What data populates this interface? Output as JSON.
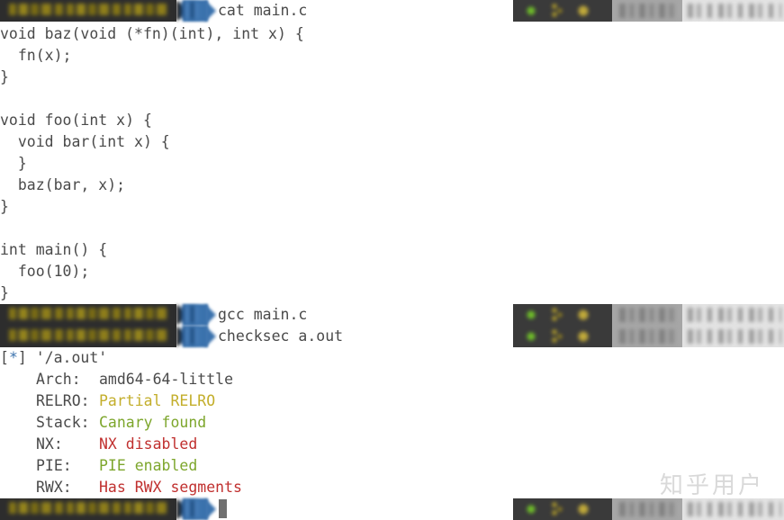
{
  "terminal": {
    "background_color": "#ffffff",
    "default_text_color": "#4a4a4a",
    "colors": {
      "yellow": "#c3ae2b",
      "green": "#7da62c",
      "red": "#c0302f",
      "blue": "#3b72ad",
      "prompt_dark": "#2d2d2d",
      "prompt_blue": "#3b72ad",
      "status_dark": "#3a3a3a",
      "status_mid": "#a6a6a6",
      "status_light": "#e3e3e3",
      "watermark": "#d9d9d9"
    },
    "prompts": {
      "redacted": true,
      "segment_text": ""
    },
    "commands": {
      "cat": "cat main.c",
      "gcc": "gcc main.c",
      "checksec": "checksec a.out"
    },
    "source_code": [
      "void baz(void (*fn)(int), int x) {",
      "  fn(x);",
      "}",
      "",
      "void foo(int x) {",
      "  void bar(int x) {",
      "  }",
      "  baz(bar, x);",
      "}",
      "",
      "int main() {",
      "  foo(10);",
      "}"
    ],
    "checksec": {
      "marker_open": "[",
      "marker_star": "*",
      "marker_close": "] ",
      "target": "'/a.out'",
      "rows": [
        {
          "label": "Arch:",
          "value": "amd64-64-little",
          "color": "default"
        },
        {
          "label": "RELRO:",
          "value": "Partial RELRO",
          "color": "yellow"
        },
        {
          "label": "Stack:",
          "value": "Canary found",
          "color": "green"
        },
        {
          "label": "NX:",
          "value": "NX disabled",
          "color": "red"
        },
        {
          "label": "PIE:",
          "value": "PIE enabled",
          "color": "green"
        },
        {
          "label": "RWX:",
          "value": "Has RWX segments",
          "color": "red"
        }
      ]
    }
  },
  "watermark": {
    "text": "知乎用户"
  }
}
